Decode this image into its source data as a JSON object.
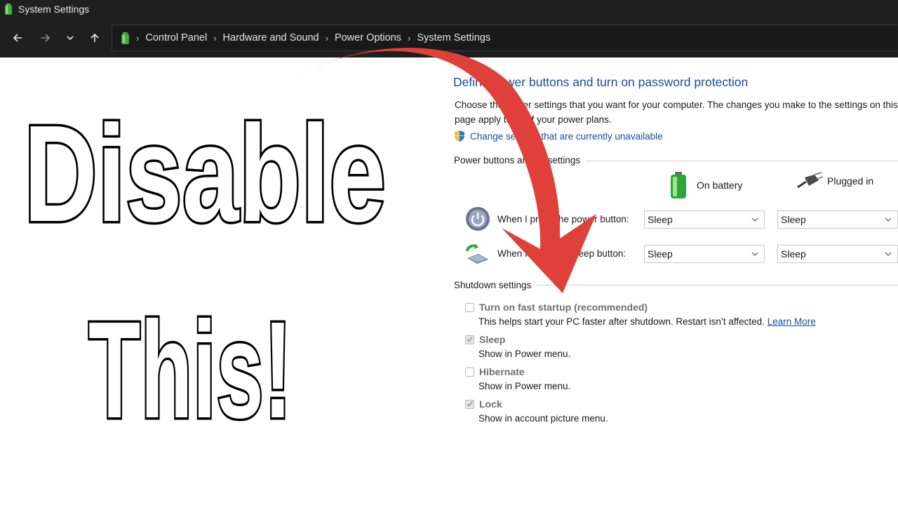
{
  "window": {
    "title": "System Settings"
  },
  "nav": {
    "back": "←",
    "forward": "→",
    "recent": "⌄",
    "up": "↑"
  },
  "breadcrumb": [
    "Control Panel",
    "Hardware and Sound",
    "Power Options",
    "System Settings"
  ],
  "breadcrumb_sep": "›",
  "page": {
    "heading": "Define power buttons and turn on password protection",
    "description_line1": "Choose the power settings that you want for your computer. The changes you make to the settings on this",
    "description_line2": "page apply to all of your power plans.",
    "shield_link": "Change settings that are currently unavailable"
  },
  "power_section": {
    "label": "Power buttons and lid settings",
    "col_battery": "On battery",
    "col_plugged": "Plugged in",
    "rows": [
      {
        "label": "When I press the power button:",
        "battery": "Sleep",
        "plugged": "Sleep",
        "icon": "power-button-icon"
      },
      {
        "label": "When I press the sleep button:",
        "battery": "Sleep",
        "plugged": "Sleep",
        "icon": "sleep-laptop-icon"
      }
    ]
  },
  "shutdown_section": {
    "label": "Shutdown settings",
    "items": [
      {
        "label": "Turn on fast startup (recommended)",
        "checked": false,
        "desc": "This helps start your PC faster after shutdown. Restart isn’t affected.",
        "link": "Learn More"
      },
      {
        "label": "Sleep",
        "checked": true,
        "desc": "Show in Power menu."
      },
      {
        "label": "Hibernate",
        "checked": false,
        "desc": "Show in Power menu."
      },
      {
        "label": "Lock",
        "checked": true,
        "desc": "Show in account picture menu."
      }
    ]
  },
  "overlay": {
    "line1": "Disable",
    "line2": "This!"
  },
  "colors": {
    "link": "#1a4c9c",
    "arrow": "#e0403a",
    "chrome": "#1f1f1f"
  }
}
